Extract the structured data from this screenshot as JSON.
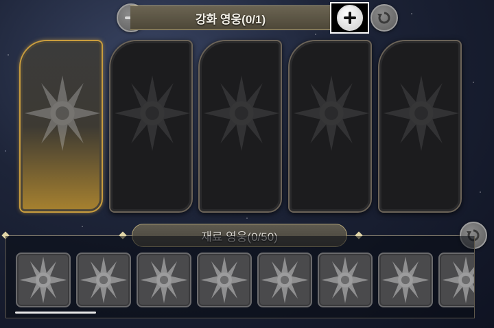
{
  "header": {
    "title": "강화 영웅(0/1)"
  },
  "slots": [
    {
      "state": "active"
    },
    {
      "state": "empty"
    },
    {
      "state": "empty"
    },
    {
      "state": "empty"
    },
    {
      "state": "empty"
    }
  ],
  "materials": {
    "title": "재료 영웅(0/50)",
    "card_count": 8
  },
  "icons": {
    "minus": "minus-icon",
    "plus": "plus-icon",
    "reset": "reset-icon",
    "emblem": "sun-emblem-icon"
  },
  "colors": {
    "accent_gold": "#c99d3e",
    "header_bg": "#5a5445"
  }
}
